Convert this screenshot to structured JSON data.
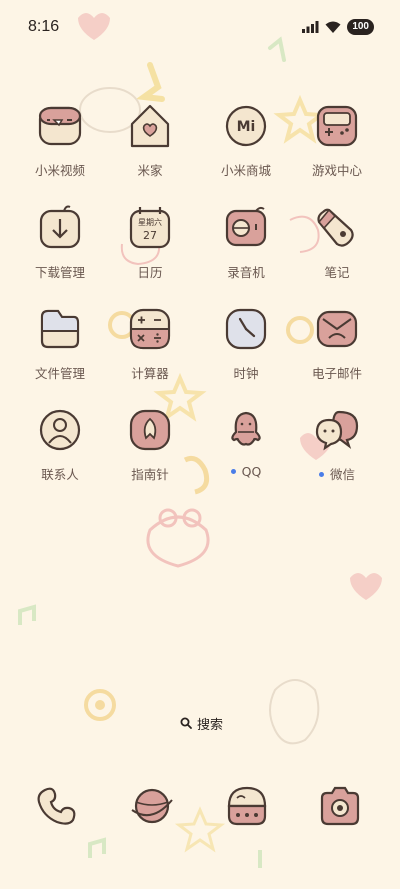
{
  "status": {
    "time": "8:16",
    "battery": "100"
  },
  "apps": [
    {
      "label": "小米视频",
      "icon": "video-icon"
    },
    {
      "label": "米家",
      "icon": "home-icon"
    },
    {
      "label": "小米商城",
      "icon": "mi-store-icon"
    },
    {
      "label": "游戏中心",
      "icon": "game-center-icon"
    },
    {
      "label": "下载管理",
      "icon": "download-icon"
    },
    {
      "label": "日历",
      "icon": "calendar-icon",
      "badge_day": "星期六",
      "badge_date": "27"
    },
    {
      "label": "录音机",
      "icon": "recorder-icon"
    },
    {
      "label": "笔记",
      "icon": "notes-icon"
    },
    {
      "label": "文件管理",
      "icon": "file-manager-icon"
    },
    {
      "label": "计算器",
      "icon": "calculator-icon"
    },
    {
      "label": "时钟",
      "icon": "clock-icon"
    },
    {
      "label": "电子邮件",
      "icon": "email-icon"
    },
    {
      "label": "联系人",
      "icon": "contacts-icon"
    },
    {
      "label": "指南针",
      "icon": "compass-icon"
    },
    {
      "label": "QQ",
      "icon": "qq-icon",
      "new": true
    },
    {
      "label": "微信",
      "icon": "wechat-icon",
      "new": true
    }
  ],
  "search": {
    "label": "搜索"
  },
  "dock": [
    {
      "icon": "phone-icon"
    },
    {
      "icon": "browser-icon"
    },
    {
      "icon": "messages-icon"
    },
    {
      "icon": "camera-icon"
    }
  ],
  "colors": {
    "background": "#fdf5e6",
    "icon_pink": "#d9a19b",
    "icon_cream": "#f4e6cf",
    "outline": "#4a3a33",
    "new_dot": "#4a7de8"
  }
}
